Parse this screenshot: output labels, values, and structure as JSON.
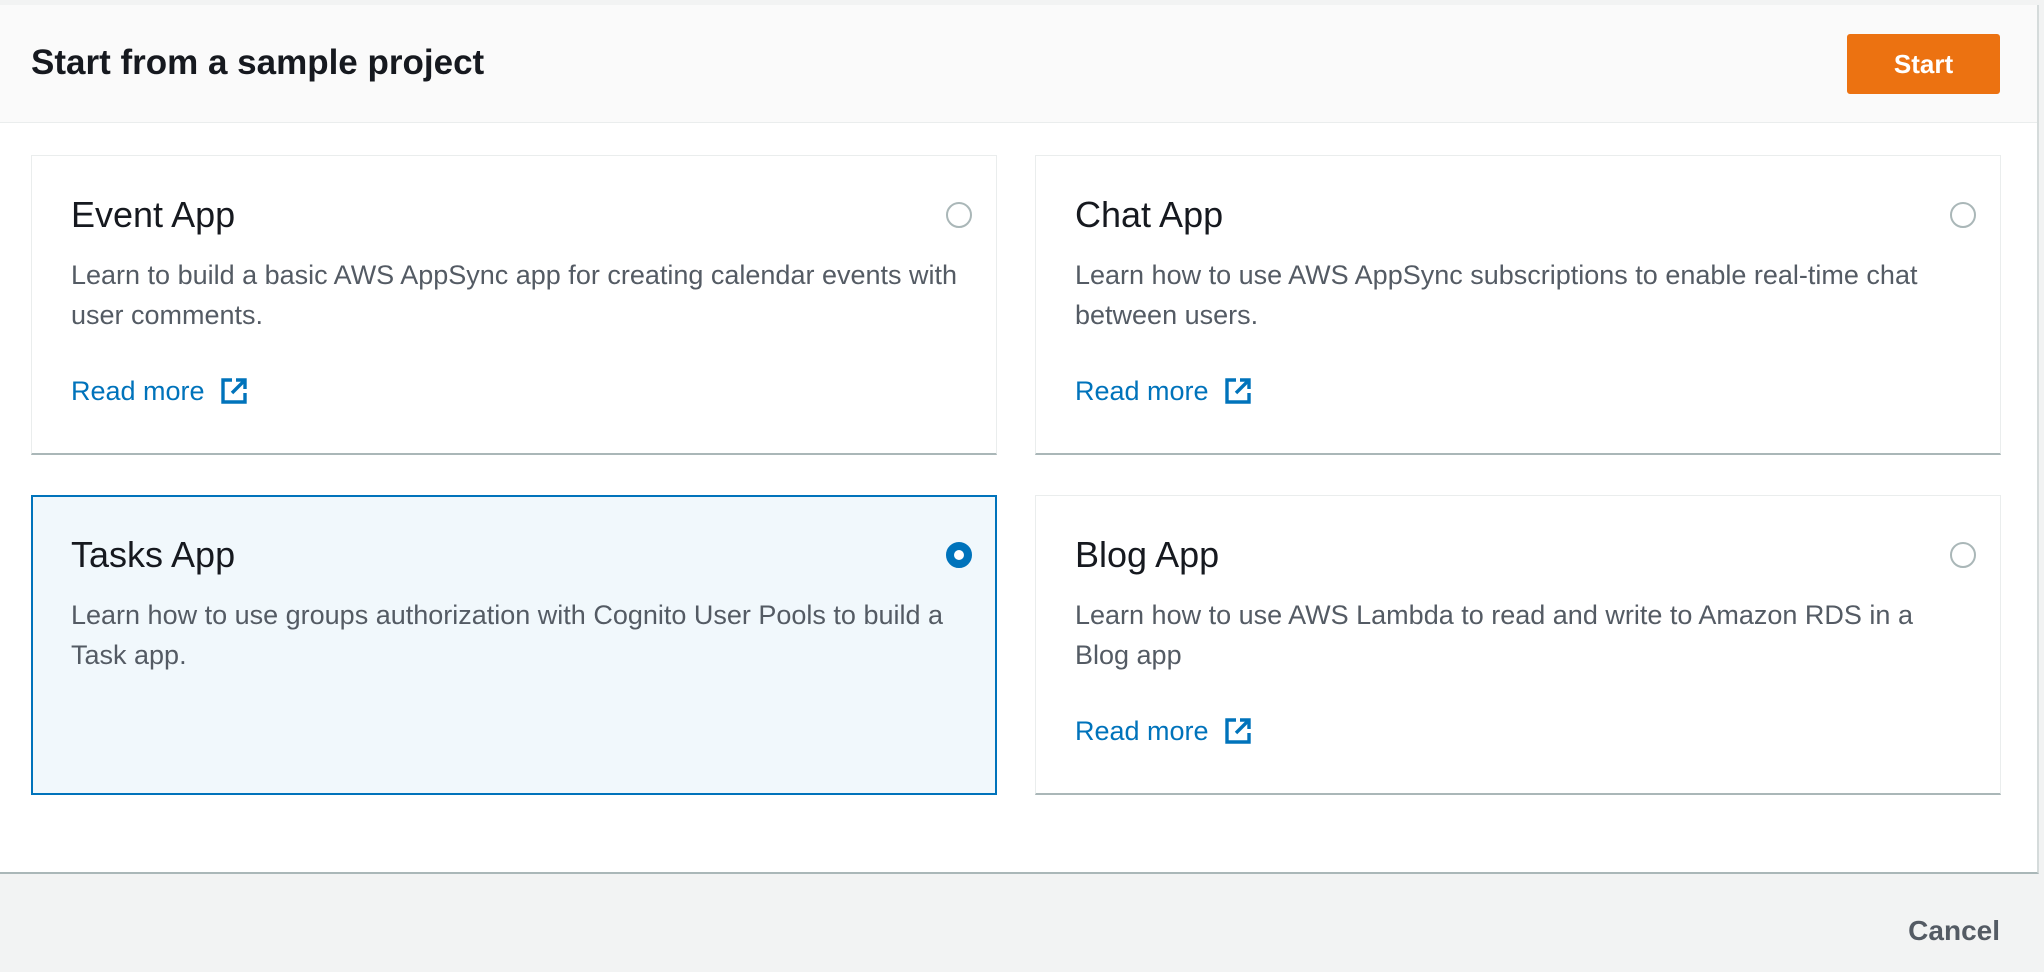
{
  "header": {
    "title": "Start from a sample project",
    "start_label": "Start"
  },
  "cards": [
    {
      "title": "Event App",
      "description": "Learn to build a basic AWS AppSync app for creating calendar events with user comments.",
      "read_more": "Read more",
      "selected": false
    },
    {
      "title": "Chat App",
      "description": "Learn how to use AWS AppSync subscriptions to enable real-time chat between users.",
      "read_more": "Read more",
      "selected": false
    },
    {
      "title": "Tasks App",
      "description": "Learn how to use groups authorization with Cognito User Pools to build a Task app.",
      "selected": true
    },
    {
      "title": "Blog App",
      "description": "Learn how to use AWS Lambda to read and write to Amazon RDS in a Blog app",
      "read_more": "Read more",
      "selected": false
    }
  ],
  "footer": {
    "cancel_label": "Cancel"
  },
  "colors": {
    "accent": "#ec7211",
    "link": "#0073bb",
    "selected_background": "#f1f8fc"
  },
  "icons": {
    "read_more": "external-link-icon"
  }
}
